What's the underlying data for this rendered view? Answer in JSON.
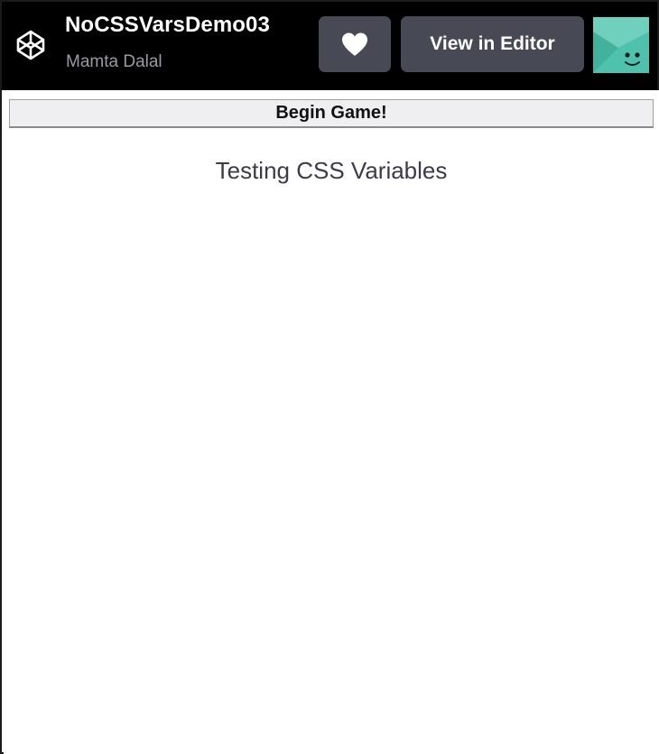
{
  "header": {
    "pen_title": "NoCSSVarsDemo03",
    "author": "Mamta Dalal",
    "logo_icon": "codepen-logo-icon",
    "like_icon": "heart-icon",
    "editor_button_label": "View in Editor",
    "avatar_icon": "avatar-smiley-icon",
    "colors": {
      "background": "#000000",
      "button": "#474a55",
      "avatar": "#4fc2ad"
    }
  },
  "result": {
    "begin_button_label": "Begin Game!",
    "heading": "Testing CSS Variables"
  }
}
